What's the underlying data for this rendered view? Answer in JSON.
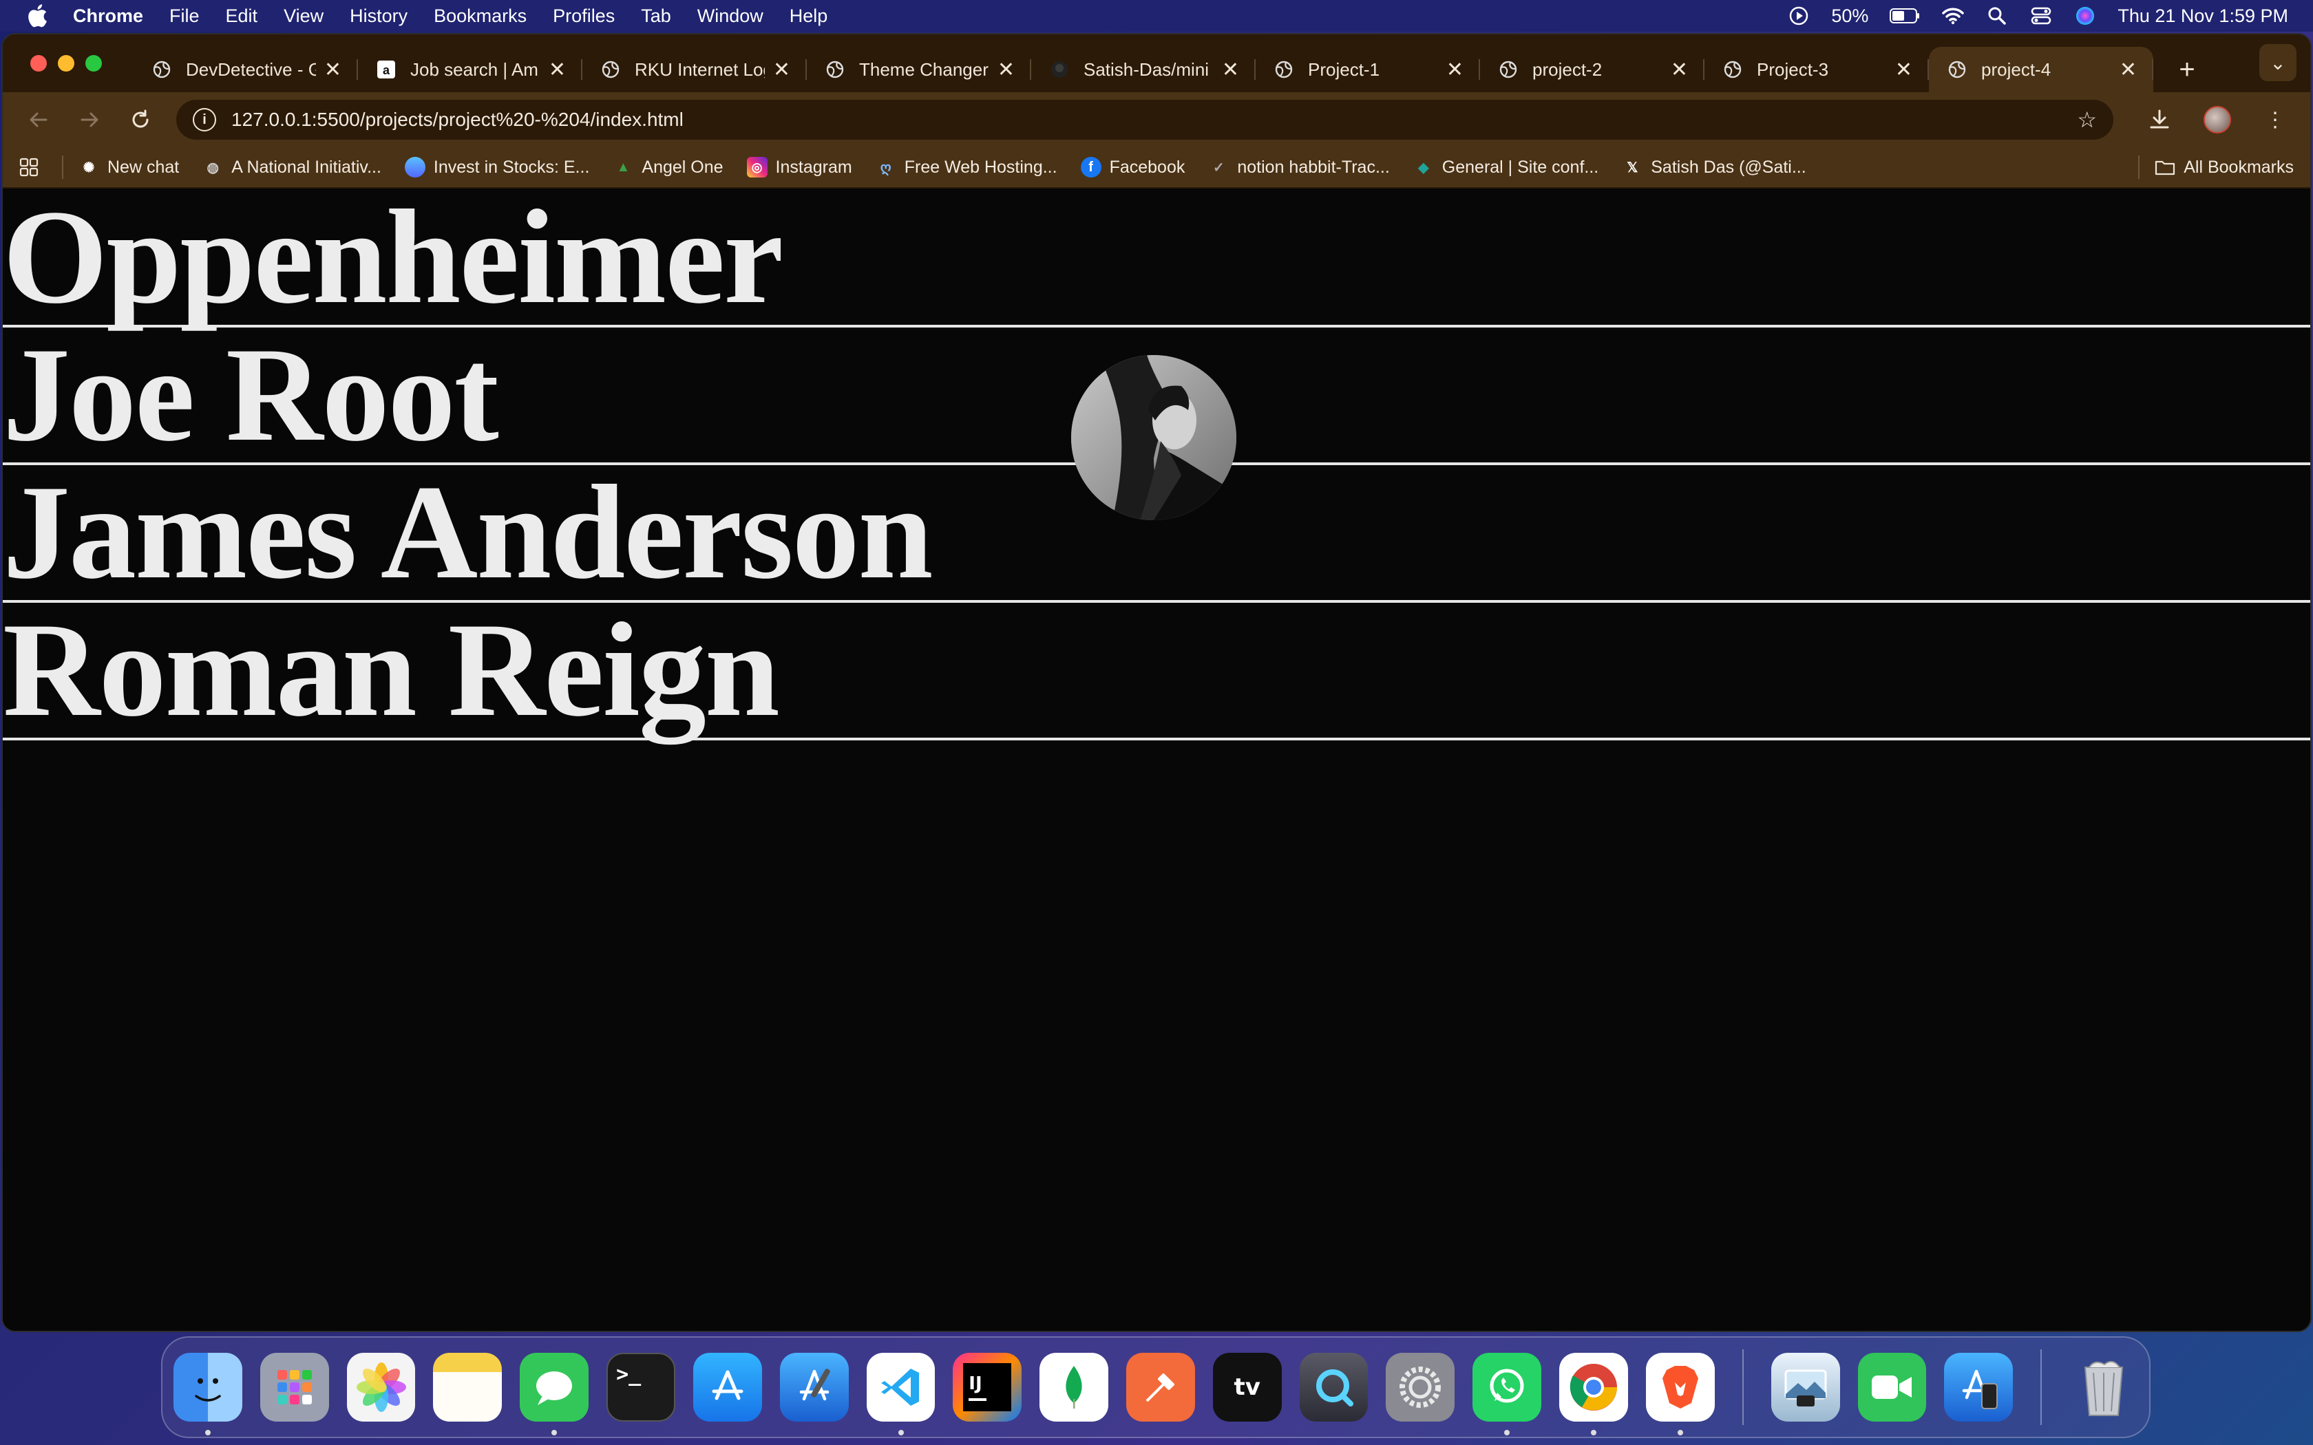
{
  "menubar": {
    "app_name": "Chrome",
    "items": [
      "File",
      "Edit",
      "View",
      "History",
      "Bookmarks",
      "Profiles",
      "Tab",
      "Window",
      "Help"
    ],
    "battery": "50%",
    "datetime": "Thu 21 Nov  1:59 PM"
  },
  "tabs": [
    {
      "title": "DevDetective - G",
      "icon": "globe-icon"
    },
    {
      "title": "Job search | Am",
      "icon": "amazon-icon"
    },
    {
      "title": "RKU Internet Log",
      "icon": "globe-icon"
    },
    {
      "title": "Theme Changer",
      "icon": "globe-icon"
    },
    {
      "title": "Satish-Das/mini",
      "icon": "github-icon"
    },
    {
      "title": "Project-1",
      "icon": "globe-icon"
    },
    {
      "title": "project-2",
      "icon": "globe-icon"
    },
    {
      "title": "Project-3",
      "icon": "globe-icon"
    },
    {
      "title": "project-4",
      "icon": "globe-icon",
      "active": true
    }
  ],
  "toolbar": {
    "url": "127.0.0.1:5500/projects/project%20-%204/index.html"
  },
  "bookmarks": [
    {
      "label": "New chat",
      "icon": "openai-icon",
      "color": "#ffffff"
    },
    {
      "label": "A National Initiativ...",
      "icon": "globe-icon",
      "color": "#cccccc"
    },
    {
      "label": "Invest in Stocks: E...",
      "icon": "groww-icon",
      "color": "#5367ff"
    },
    {
      "label": "Angel One",
      "icon": "angelone-icon",
      "color": "#3aa14a"
    },
    {
      "label": "Instagram",
      "icon": "instagram-icon",
      "color": "#e1306c"
    },
    {
      "label": "Free Web Hosting...",
      "icon": "hosting-icon",
      "color": "#7ab8ff"
    },
    {
      "label": "Facebook",
      "icon": "facebook-icon",
      "color": "#1877f2"
    },
    {
      "label": "notion habbit-Trac...",
      "icon": "check-icon",
      "color": "#aaaaaa"
    },
    {
      "label": "General | Site conf...",
      "icon": "netlify-icon",
      "color": "#1fa39a"
    },
    {
      "label": "Satish Das (@Sati...",
      "icon": "x-icon",
      "color": "#ffffff"
    }
  ],
  "all_bookmarks_label": "All Bookmarks",
  "page": {
    "names": [
      "Oppenheimer",
      "Joe Root",
      "James Anderson",
      "Roman Reign"
    ]
  },
  "dock": [
    {
      "name": "finder-icon",
      "color": "#3c8cf0",
      "running": true
    },
    {
      "name": "launchpad-icon",
      "color": "#9aa0b0",
      "running": false
    },
    {
      "name": "photos-icon",
      "color": "#f4f4f4",
      "running": false
    },
    {
      "name": "notes-icon",
      "color": "#f7d04a",
      "running": false
    },
    {
      "name": "messages-icon",
      "color": "#33c759",
      "running": true
    },
    {
      "name": "terminal-icon",
      "color": "#1b1b1b",
      "running": false
    },
    {
      "name": "app-store-icon",
      "color": "#1f8ef1",
      "running": false
    },
    {
      "name": "xcode-icon",
      "color": "#2d7de0",
      "running": false
    },
    {
      "name": "vscode-icon",
      "color": "#ffffff",
      "running": true
    },
    {
      "name": "intellij-icon",
      "color": "#e8334a",
      "running": false
    },
    {
      "name": "mongodb-icon",
      "color": "#ffffff",
      "running": false
    },
    {
      "name": "postman-icon",
      "color": "#f36b3a",
      "running": false
    },
    {
      "name": "apple-tv-icon",
      "color": "#111111",
      "running": false
    },
    {
      "name": "quicktime-icon",
      "color": "#4a4a55",
      "running": false
    },
    {
      "name": "system-settings-icon",
      "color": "#8a8a92",
      "running": false
    },
    {
      "name": "whatsapp-icon",
      "color": "#25d366",
      "running": true
    },
    {
      "name": "chrome-icon",
      "color": "#ffffff",
      "running": true
    },
    {
      "name": "brave-icon",
      "color": "#fb542b",
      "running": true
    },
    {
      "name": "preview-icon",
      "color": "#c7d8e6",
      "running": false
    },
    {
      "name": "facetime-icon",
      "color": "#30c45a",
      "running": false
    },
    {
      "name": "simulator-icon",
      "color": "#2d7de0",
      "running": false
    },
    {
      "name": "trash-icon",
      "color": "#b8bcc4",
      "running": false
    }
  ]
}
